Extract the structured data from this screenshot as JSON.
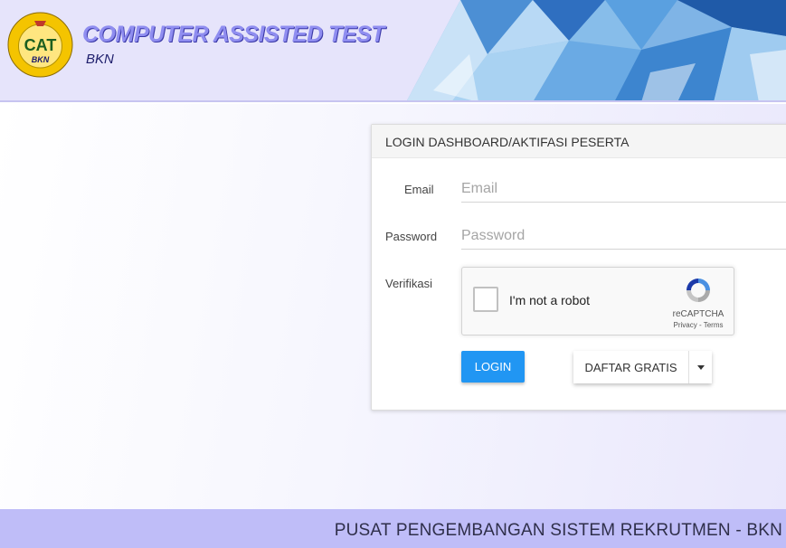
{
  "header": {
    "logo_text": "CAT",
    "logo_sub": "BKN",
    "title": "COMPUTER ASSISTED TEST",
    "subtitle": "BKN"
  },
  "login_card": {
    "title": "LOGIN DASHBOARD/AKTIFASI PESERTA",
    "email_label": "Email",
    "email_placeholder": "Email",
    "password_label": "Password",
    "password_placeholder": "Password",
    "verification_label": "Verifikasi",
    "captcha": {
      "text": "I'm not a robot",
      "brand": "reCAPTCHA",
      "links": "Privacy - Terms"
    },
    "login_button": "LOGIN",
    "register_button": "DAFTAR GRATIS"
  },
  "footer": {
    "text": "PUSAT PENGEMBANGAN SISTEM REKRUTMEN - BKN"
  },
  "colors": {
    "primary": "#2196f3",
    "header_bg": "#e6e4fb",
    "footer_bg": "#bfbdf8"
  }
}
